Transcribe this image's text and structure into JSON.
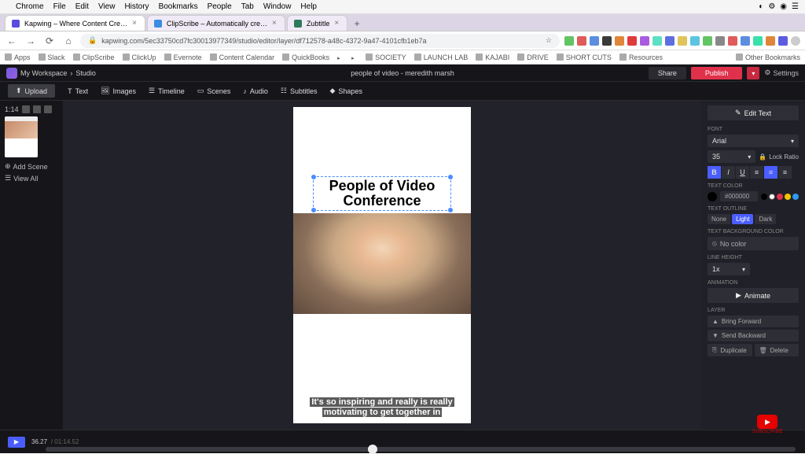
{
  "mac_menu": {
    "items": [
      "Chrome",
      "File",
      "Edit",
      "View",
      "History",
      "Bookmarks",
      "People",
      "Tab",
      "Window",
      "Help"
    ]
  },
  "tabs": [
    {
      "title": "Kapwing – Where Content Cre…",
      "favicon": "kw",
      "active": true
    },
    {
      "title": "ClipScribe – Automatically cre…",
      "favicon": "cs",
      "active": false
    },
    {
      "title": "Zubtitle",
      "favicon": "zu",
      "active": false
    }
  ],
  "url": "kapwing.com/5ec33750cd7fc30013977349/studio/editor/layer/df712578-a48c-4372-9a47-4101cfb1eb7a",
  "bookmarks": [
    "Apps",
    "Slack",
    "ClipScribe",
    "ClickUp",
    "Evernote",
    "Content Calendar",
    "QuickBooks",
    "SOCIETY",
    "LAUNCH LAB",
    "KAJABI",
    "DRIVE",
    "SHORT CUTS",
    "Resources"
  ],
  "other_bookmarks": "Other Bookmarks",
  "header": {
    "workspace": "My Workspace",
    "breadcrumb": "Studio",
    "project_title": "people of video - meredith marsh",
    "share": "Share",
    "publish": "Publish",
    "settings": "Settings"
  },
  "toolbar": {
    "upload": "Upload",
    "items": [
      "Text",
      "Images",
      "Timeline",
      "Scenes",
      "Audio",
      "Subtitles",
      "Shapes"
    ]
  },
  "left": {
    "timecode": "1:14",
    "add_scene": "Add Scene",
    "view_all": "View All"
  },
  "canvas": {
    "headline": "People of Video Conference",
    "subtitle": "It's so inspiring and really is really motivating to get together in"
  },
  "right": {
    "edit_text": "Edit Text",
    "font_label": "FONT",
    "font_value": "Arial",
    "font_size": "35",
    "lock_ratio": "Lock Ratio",
    "text_color_label": "TEXT COLOR",
    "text_color_hex": "#000000",
    "swatches": [
      "#000000",
      "#ffffff",
      "#e0314b",
      "#f2c400",
      "#2e9bf0"
    ],
    "outline_label": "TEXT OUTLINE",
    "outline_options": [
      "None",
      "Light",
      "Dark"
    ],
    "bg_label": "TEXT BACKGROUND COLOR",
    "no_color": "No color",
    "lineheight_label": "LINE HEIGHT",
    "lineheight_value": "1x",
    "animation_label": "ANIMATION",
    "animate": "Animate",
    "layer_label": "LAYER",
    "bring_forward": "Bring Forward",
    "send_backward": "Send Backward",
    "duplicate": "Duplicate",
    "delete": "Delete"
  },
  "timeline": {
    "current": "36.27",
    "duration": "01:14.52"
  },
  "youtube": {
    "subscribe": "SUBSCRIBE"
  }
}
